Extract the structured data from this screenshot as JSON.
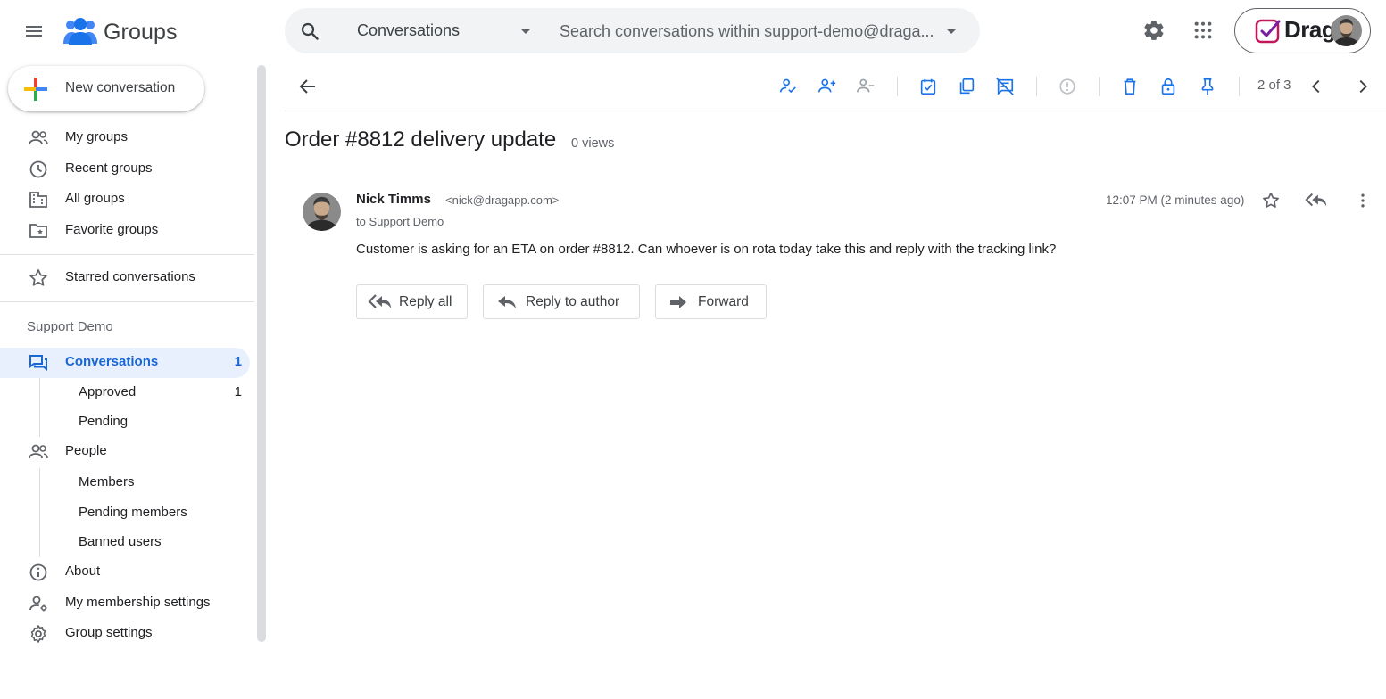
{
  "app": {
    "name": "Groups"
  },
  "colors": {
    "accent": "#1967d2",
    "selected_bg": "#e8f0fe",
    "icon_blue": "#1a73e8",
    "icon_grey": "#5f6368"
  },
  "search": {
    "scope": "Conversations",
    "placeholder": "Search conversations within support-demo@draga..."
  },
  "account": {
    "brand": "Drag"
  },
  "sidebar": {
    "new_conversation": "New conversation",
    "top_items": [
      {
        "label": "My groups",
        "icon": "people-icon"
      },
      {
        "label": "Recent groups",
        "icon": "clock-icon"
      },
      {
        "label": "All groups",
        "icon": "building-icon"
      },
      {
        "label": "Favorite groups",
        "icon": "folder-star-icon"
      }
    ],
    "starred": "Starred conversations",
    "group_heading": "Support Demo",
    "conversations": {
      "label": "Conversations",
      "count": "1"
    },
    "approved": {
      "label": "Approved",
      "count": "1"
    },
    "pending": {
      "label": "Pending"
    },
    "people": {
      "label": "People"
    },
    "members": {
      "label": "Members"
    },
    "pending_members": {
      "label": "Pending members"
    },
    "banned_users": {
      "label": "Banned users"
    },
    "about": {
      "label": "About"
    },
    "membership_settings": {
      "label": "My membership settings"
    },
    "group_settings": {
      "label": "Group settings"
    }
  },
  "toolbar": {
    "pager": "2 of 3"
  },
  "conversation": {
    "title": "Order #8812 delivery update",
    "views": "0 views",
    "message": {
      "author": "Nick Timms",
      "email": "<nick@dragapp.com>",
      "recipient": "to Support Demo",
      "time": "12:07 PM (2 minutes ago)",
      "body": "Customer is asking for an ETA on order #8812. Can whoever is on rota today take this and reply with the tracking link?"
    },
    "actions": {
      "reply_all": "Reply all",
      "reply_author": "Reply to author",
      "forward": "Forward"
    }
  }
}
